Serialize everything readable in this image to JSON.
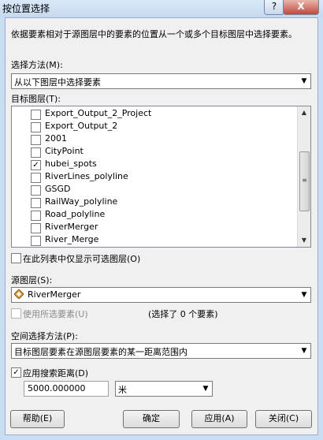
{
  "window": {
    "title": "按位置选择",
    "help_glyph": "?",
    "close_glyph": "X"
  },
  "description": "依据要素相对于源图层中的要素的位置从一个或多个目标图层中选择要素。",
  "selection_method": {
    "label": "选择方法(M):",
    "value": "从以下图层中选择要素"
  },
  "target_layers": {
    "label": "目标图层(T):",
    "items": [
      {
        "name": "Export_Output_2_Project",
        "checked": false
      },
      {
        "name": "Export_Output_2",
        "checked": false
      },
      {
        "name": "2001",
        "checked": false
      },
      {
        "name": "CityPoint",
        "checked": false
      },
      {
        "name": "hubei_spots",
        "checked": true
      },
      {
        "name": "RiverLines_polyline",
        "checked": false
      },
      {
        "name": "GSGD",
        "checked": false
      },
      {
        "name": "RailWay_polyline",
        "checked": false
      },
      {
        "name": "Road_polyline",
        "checked": false
      },
      {
        "name": "RiverMerger",
        "checked": false
      },
      {
        "name": "River_Merge",
        "checked": false
      }
    ]
  },
  "only_selectable": {
    "label": "在此列表中仅显示可选图层(O)",
    "checked": false
  },
  "source_layer": {
    "label": "源图层(S):",
    "value": "RiverMerger",
    "icon": "polygon-layer-icon"
  },
  "use_selected": {
    "label": "使用所选要素(U)",
    "checked": false,
    "status": "(选择了 0 个要素)"
  },
  "spatial_method": {
    "label": "空间选择方法(P):",
    "value": "目标图层要素在源图层要素的某一距离范围内"
  },
  "search_distance": {
    "label": "应用搜索距离(D)",
    "checked": true,
    "value": "5000.000000",
    "unit": "米"
  },
  "buttons": {
    "help": "帮助(E)",
    "ok": "确定",
    "apply": "应用(A)",
    "close": "关闭(C)"
  },
  "colors": {
    "accent": "#c9def3",
    "close_button": "#c4463a"
  }
}
